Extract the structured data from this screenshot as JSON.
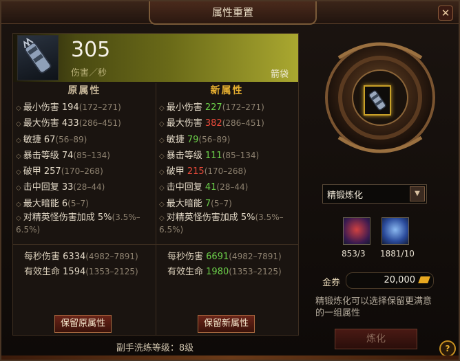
{
  "window": {
    "title": "属性重置",
    "close_glyph": "✕"
  },
  "item": {
    "dps_value": "305",
    "dps_label": "伤害／秒",
    "type": "箭袋",
    "icon": "quiver-icon"
  },
  "columns": {
    "original_title": "原属性",
    "new_title": "新属性"
  },
  "original_stats": [
    {
      "name": "最小伤害",
      "value": "194",
      "range": "(172–271)"
    },
    {
      "name": "最大伤害",
      "value": "433",
      "range": "(286–451)"
    },
    {
      "name": "敏捷",
      "value": "67",
      "range": "(56–89)"
    },
    {
      "name": "暴击等级",
      "value": "74",
      "range": "(85–134)"
    },
    {
      "name": "破甲",
      "value": "257",
      "range": "(170–268)"
    },
    {
      "name": "击中回复",
      "value": "33",
      "range": "(28–44)"
    },
    {
      "name": "最大暗能",
      "value": "6",
      "range": "(5–7)"
    },
    {
      "name": "对精英怪伤害加成",
      "value": "5%",
      "range": "(3.5%–6.5%)"
    }
  ],
  "new_stats": [
    {
      "name": "最小伤害",
      "value": "227",
      "range": "(172–271)",
      "trend": "up"
    },
    {
      "name": "最大伤害",
      "value": "382",
      "range": "(286–451)",
      "trend": "down"
    },
    {
      "name": "敏捷",
      "value": "79",
      "range": "(56–89)",
      "trend": "up"
    },
    {
      "name": "暴击等级",
      "value": "111",
      "range": "(85–134)",
      "trend": "up"
    },
    {
      "name": "破甲",
      "value": "215",
      "range": "(170–268)",
      "trend": "down"
    },
    {
      "name": "击中回复",
      "value": "41",
      "range": "(28–44)",
      "trend": "up"
    },
    {
      "name": "最大暗能",
      "value": "7",
      "range": "(5–7)",
      "trend": "up"
    },
    {
      "name": "对精英怪伤害加成",
      "value": "5%",
      "range": "(3.5%–6.5%)",
      "trend": "same"
    }
  ],
  "original_summary": [
    {
      "name": "每秒伤害",
      "value": "6334",
      "range": "(4982–7891)"
    },
    {
      "name": "有效生命",
      "value": "1594",
      "range": "(1353–2125)"
    }
  ],
  "new_summary": [
    {
      "name": "每秒伤害",
      "value": "6691",
      "range": "(4982–7891)"
    },
    {
      "name": "有效生命",
      "value": "1980",
      "range": "(1353–2125)"
    }
  ],
  "buttons": {
    "keep_original": "保留原属性",
    "keep_new": "保留新属性",
    "refine": "炼化",
    "help": "?"
  },
  "refine_level": "副手洗练等级：8级",
  "mode_select": {
    "value": "精锻炼化"
  },
  "materials": [
    {
      "icon": "pouch-icon",
      "count": "853/3"
    },
    {
      "icon": "crystal-icon",
      "count": "1881/10"
    }
  ],
  "gold": {
    "label": "金券",
    "value": "20,000"
  },
  "hint": "精锻炼化可以选择保留更满意的一组属性",
  "colors": {
    "up": "#6cd04a",
    "down": "#e84a3a",
    "accent": "#e8b030"
  }
}
